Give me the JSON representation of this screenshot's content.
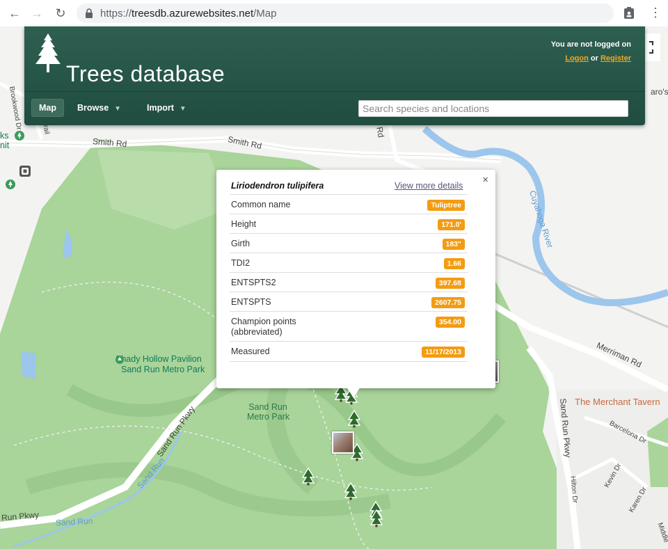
{
  "browser": {
    "url_host": "treesdb.azurewebsites.net",
    "url_path": "/Map",
    "icons": [
      "back-icon",
      "forward-icon",
      "reload-icon",
      "lock-icon",
      "profile-icon",
      "menu-icon"
    ]
  },
  "header": {
    "brand": "Trees database",
    "login_text": "You are not logged on",
    "logon_label": "Logon",
    "or_text": "or",
    "register_label": "Register",
    "nav": [
      {
        "label": "Map",
        "active": true
      },
      {
        "label": "Browse",
        "active": false,
        "dropdown": true
      },
      {
        "label": "Import",
        "active": false,
        "dropdown": true
      }
    ],
    "search_placeholder": "Search species and locations",
    "colors": {
      "panel": "#2e5f50",
      "accent": "#f5a623"
    }
  },
  "map": {
    "labels": [
      "Smith Rd",
      "Smith Rd",
      "Brookwood Dr",
      "Trail",
      "Cuyahoga River",
      "Merriman Rd",
      "Shady Hollow Pavilion",
      "Sand Run Metro Park",
      "Sand Run Metro Park",
      "Sand Run Pkwy",
      "Sand Run",
      "Sand Run",
      "Run Pkwy",
      "Sand Run Pkwy",
      "The Merchant Tavern",
      "Barcelona Dr",
      "Hilton Dr",
      "Kevin Dr",
      "Karen Dr",
      "Middle",
      "aro's",
      "n Rd",
      "ks",
      "nit"
    ]
  },
  "popup": {
    "species": "Liriodendron tulipifera",
    "more_label": "View more details",
    "rows": [
      {
        "label": "Common name",
        "value": "Tuliptree"
      },
      {
        "label": "Height",
        "value": "171.0'"
      },
      {
        "label": "Girth",
        "value": "183\""
      },
      {
        "label": "TDI2",
        "value": "1.66"
      },
      {
        "label": "ENTSPTS2",
        "value": "397.68"
      },
      {
        "label": "ENTSPTS",
        "value": "2607.75"
      },
      {
        "label": "Champion points (abbreviated)",
        "value": "354.00"
      },
      {
        "label": "Measured",
        "value": "11/17/2013"
      }
    ],
    "badge_color": "#f39c12"
  }
}
